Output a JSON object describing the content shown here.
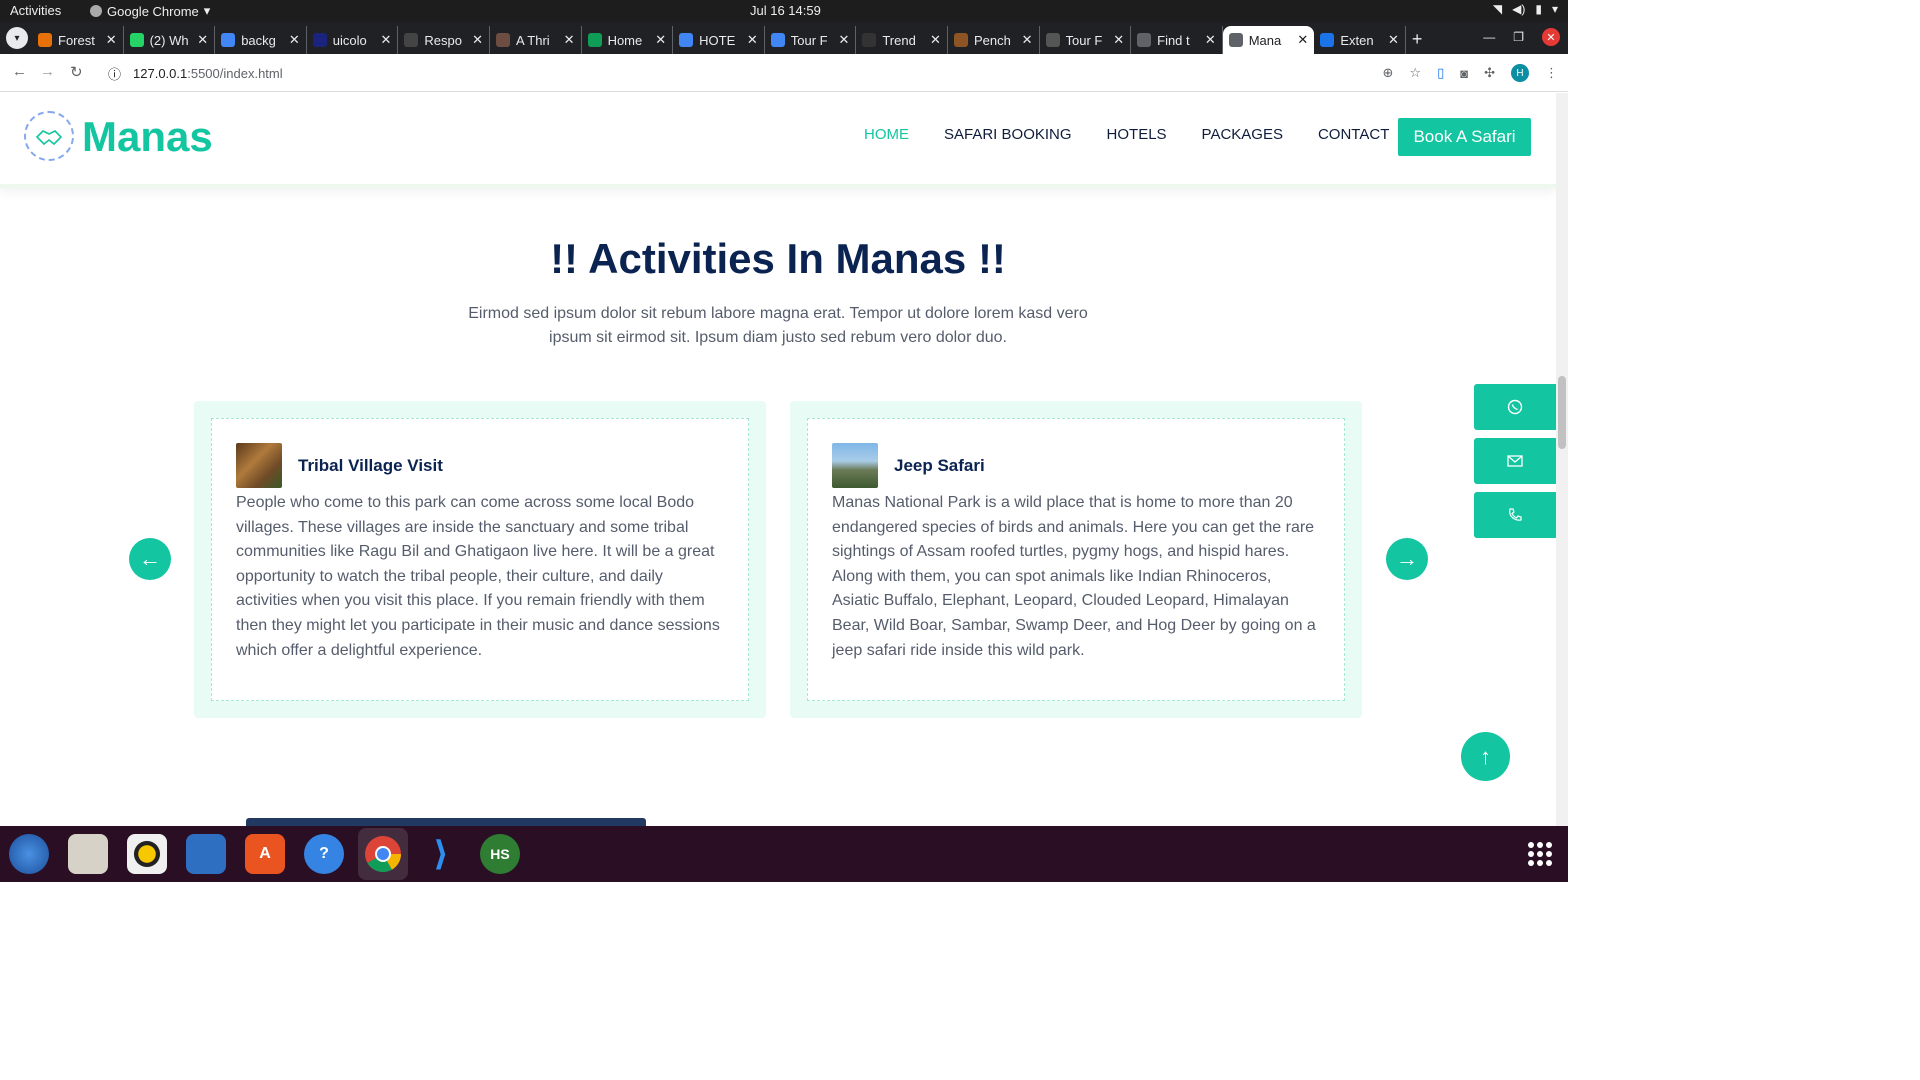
{
  "os": {
    "activities": "Activities",
    "app_name": "Google Chrome",
    "clock": "Jul 16  14:59"
  },
  "browser": {
    "tabs": [
      {
        "title": "Forest",
        "color": "#e8710a"
      },
      {
        "title": "(2) Wh",
        "color": "#25d366"
      },
      {
        "title": "backg",
        "color": "#4285f4"
      },
      {
        "title": "uicolo",
        "color": "#1a237e"
      },
      {
        "title": "Respo",
        "color": "#444444"
      },
      {
        "title": "A Thri",
        "color": "#6d4c41"
      },
      {
        "title": "Home",
        "color": "#0f9d58"
      },
      {
        "title": "HOTE",
        "color": "#4285f4"
      },
      {
        "title": "Tour F",
        "color": "#4285f4"
      },
      {
        "title": "Trend",
        "color": "#333333"
      },
      {
        "title": "Pench",
        "color": "#8d5524"
      },
      {
        "title": "Tour F",
        "color": "#555555"
      },
      {
        "title": "Find t",
        "color": "#5f6368"
      },
      {
        "title": "Mana",
        "color": "#5f6368",
        "active": true
      },
      {
        "title": "Exten",
        "color": "#1a73e8"
      }
    ],
    "url_host": "127.0.0.1",
    "url_path": ":5500/index.html",
    "profile_initial": "H"
  },
  "site": {
    "brand": "Manas",
    "nav": [
      "HOME",
      "SAFARI BOOKING",
      "HOTELS",
      "PACKAGES",
      "CONTACT"
    ],
    "cta": "Book A Safari",
    "accent": "#13c5a0",
    "heading_color": "#0a2351"
  },
  "activities": {
    "title": "!! Activities In Manas !!",
    "subtitle": "Eirmod sed ipsum dolor sit rebum labore magna erat. Tempor ut dolore lorem kasd vero ipsum sit eirmod sit. Ipsum diam justo sed rebum vero dolor duo.",
    "cards": [
      {
        "title": "Tribal Village Visit",
        "text": "People who come to this park can come across some local Bodo villages. These villages are inside the sanctuary and some tribal communities like Ragu Bil and Ghatigaon live here. It will be a great opportunity to watch the tribal people, their culture, and daily activities when you visit this place. If you remain friendly with them then they might let you participate in their music and dance sessions which offer a delightful experience."
      },
      {
        "title": "Jeep Safari",
        "text": "Manas National Park is a wild place that is home to more than 20 endangered species of birds and animals. Here you can get the rare sightings of Assam roofed turtles, pygmy hogs, and hispid hares. Along with them, you can spot animals like Indian Rhinoceros, Asiatic Buffalo, Elephant, Leopard, Clouded Leopard, Himalayan Bear, Wild Boar, Sambar, Swamp Deer, and Hog Deer by going on a jeep safari ride inside this wild park."
      }
    ]
  },
  "icons": {
    "prev": "arrow-left-icon",
    "next": "arrow-right-icon",
    "whatsapp": "whatsapp-icon",
    "email": "envelope-icon",
    "phone": "phone-icon",
    "back_to_top": "arrow-up-icon"
  }
}
